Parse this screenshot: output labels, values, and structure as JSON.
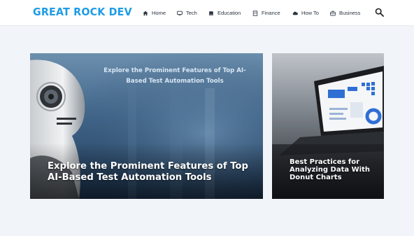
{
  "site": {
    "logo": "GREAT ROCK DEV"
  },
  "nav": [
    {
      "label": "Home",
      "icon": "home-icon"
    },
    {
      "label": "Tech",
      "icon": "monitor-icon"
    },
    {
      "label": "Education",
      "icon": "book-icon"
    },
    {
      "label": "Finance",
      "icon": "building-icon"
    },
    {
      "label": "How To",
      "icon": "cloud-icon"
    },
    {
      "label": "Business",
      "icon": "briefcase-icon"
    }
  ],
  "search": {
    "icon": "search-icon"
  },
  "featured": {
    "main": {
      "banner_text": "Explore the Prominent Features of Top AI-Based Test Automation Tools",
      "title": "Explore the Prominent Features of Top AI-Based Test Automation Tools"
    },
    "side": {
      "title": "Best Practices for Analyzing Data With Donut Charts"
    }
  },
  "colors": {
    "brand": "#1e9ce5",
    "page_background": "#f1f5f9",
    "header_background": "#ffffff"
  }
}
